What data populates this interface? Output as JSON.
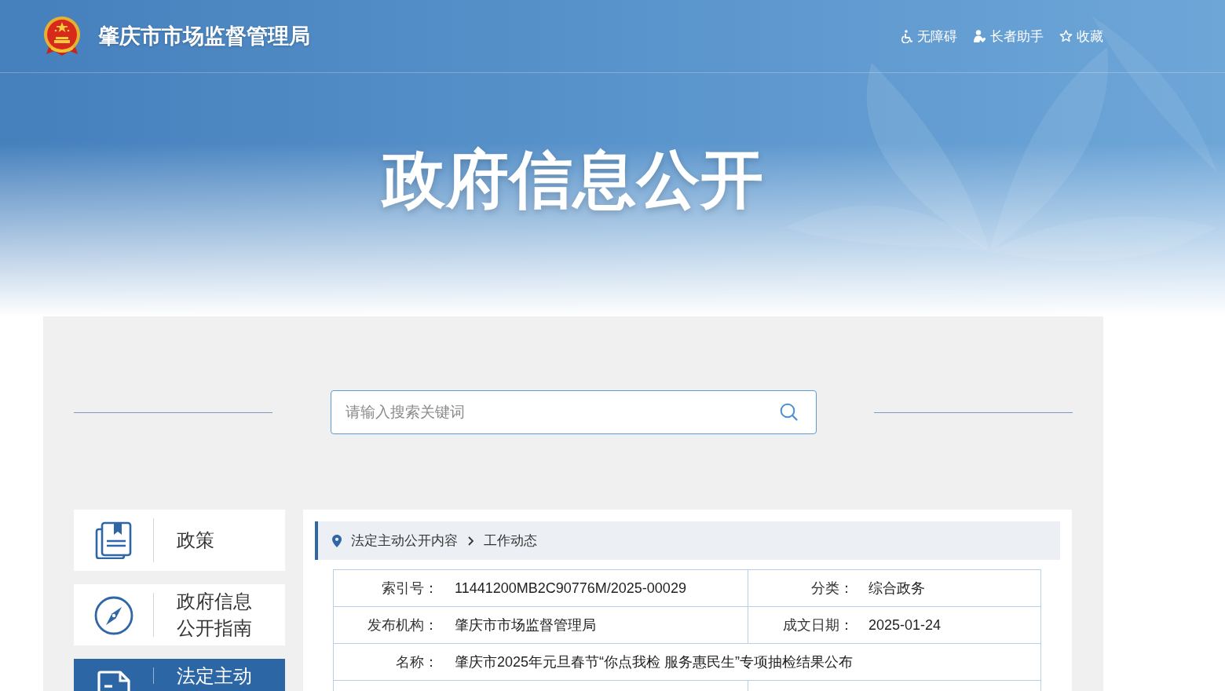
{
  "header": {
    "site_title": "肇庆市市场监督管理局",
    "links": [
      {
        "kind": "accessibility",
        "label": "无障碍"
      },
      {
        "kind": "elder",
        "label": "长者助手"
      },
      {
        "kind": "favorite",
        "label": "收藏"
      }
    ]
  },
  "banner": {
    "title": "政府信息公开"
  },
  "search": {
    "placeholder": "请输入搜索关键词"
  },
  "sidebar": {
    "items": [
      {
        "kind": "policy",
        "label": "政策",
        "selected": false
      },
      {
        "kind": "guide",
        "label": "政府信息公开指南",
        "selected": false
      },
      {
        "kind": "document",
        "label": "法定主动",
        "selected": true
      }
    ]
  },
  "breadcrumb": [
    {
      "label": "法定主动公开内容"
    },
    {
      "label": "工作动态"
    }
  ],
  "document_info": {
    "rows": [
      {
        "cells": [
          {
            "label": "索引号：",
            "value": "11441200MB2C90776M/2025-00029"
          },
          {
            "label": "分类：",
            "value": "综合政务"
          }
        ]
      },
      {
        "cells": [
          {
            "label": "发布机构：",
            "value": "肇庆市市场监督管理局"
          },
          {
            "label": "成文日期：",
            "value": "2025-01-24"
          }
        ]
      },
      {
        "cells": [
          {
            "label": "名称：",
            "value": "肇庆市2025年元旦春节“你点我检 服务惠民生”专项抽检结果公布"
          }
        ]
      }
    ]
  }
}
